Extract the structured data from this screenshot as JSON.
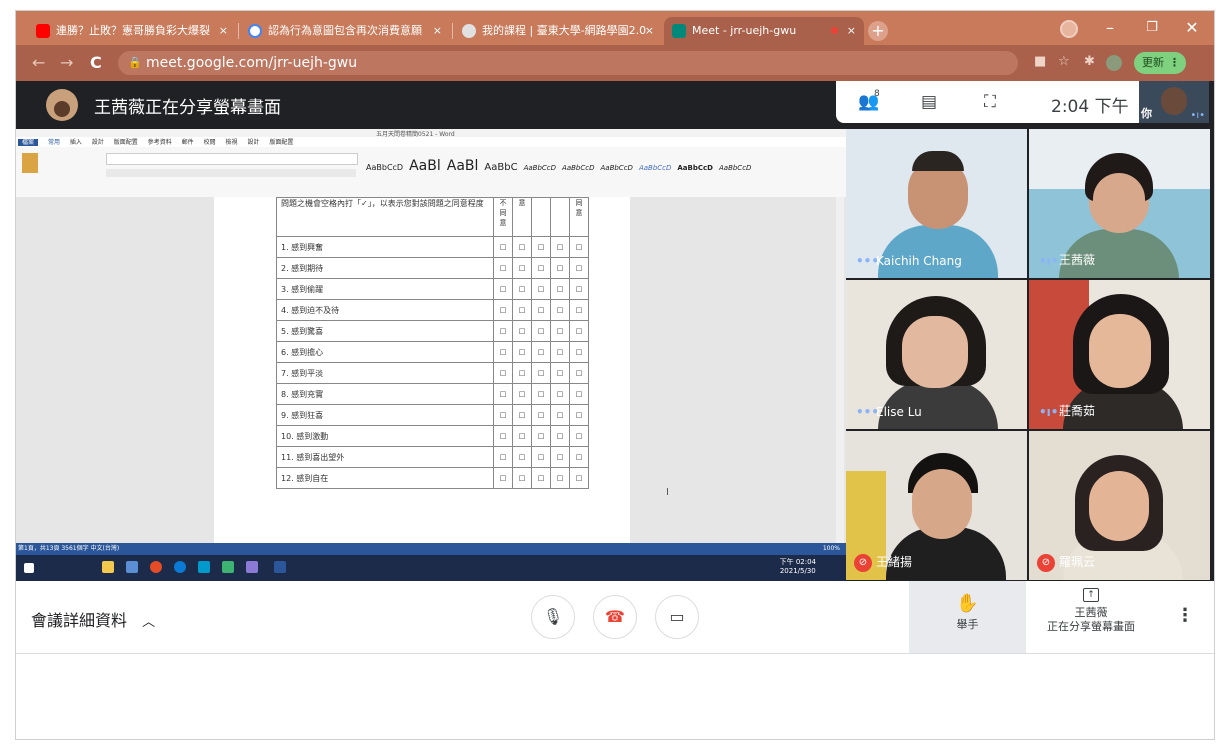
{
  "browser": {
    "tabs": [
      {
        "title": "連勝？止敗？憲哥勝負彩大爆裂",
        "icon_color": "#ff0000",
        "icon": "youtube-icon"
      },
      {
        "title": "認為行為意圖包含再次消費意願",
        "icon_color": "#4285f4",
        "icon": "google-icon"
      },
      {
        "title": "我的課程 | 臺東大學-網路學園2.0",
        "icon_color": "#555555",
        "icon": "globe-icon"
      },
      {
        "title": "Meet - jrr-uejh-gwu",
        "icon_color": "#00897b",
        "icon": "meet-icon"
      }
    ],
    "tab_close": "×",
    "new_tab": "+",
    "window": {
      "minimize": "–",
      "maximize": "❐",
      "close": "✕"
    },
    "url": "meet.google.com/jrr-uejh-gwu",
    "update_label": "更新",
    "nav": {
      "back": "←",
      "forward": "→",
      "reload": "C"
    }
  },
  "meet": {
    "presenter_banner": "王茜薇正在分享螢幕畫面",
    "participants_count": "8",
    "clock": "2:04 下午",
    "self_label": "你",
    "participants": [
      {
        "name": "Kaichih Chang",
        "status": "speaking-dots"
      },
      {
        "name": "王茜薇",
        "status": "audio"
      },
      {
        "name": "Elise Lu",
        "status": "speaking-dots"
      },
      {
        "name": "莊喬茹",
        "status": "audio"
      },
      {
        "name": "王緒揚",
        "status": "muted"
      },
      {
        "name": "羅珮云",
        "status": "muted"
      }
    ],
    "controls": {
      "meeting_details": "會議詳細資料",
      "raise_hand": "舉手",
      "presenter_name": "王茜薇",
      "presenting_label": "正在分享螢幕畫面"
    }
  },
  "shared_doc": {
    "title": "五月天問卷精簡0521 - Word",
    "ribbon_tabs": [
      "檔案",
      "常用",
      "插入",
      "設計",
      "版面配置",
      "參考資料",
      "郵件",
      "校閱",
      "檢視",
      "設計",
      "版面配置"
    ],
    "styles": [
      "AaBbCcD",
      "AaBl",
      "AaBl",
      "AaBbC",
      "AaBbCcD",
      "AaBbCcD",
      "AaBbCcD",
      "AaBbCcD",
      "AaBbCcD",
      "AaBbCcD"
    ],
    "header_text": "問題之機會空格內打「✓」，以表示您對該問題之同意程度",
    "col_header_1": "不同意",
    "col_header_2": "意",
    "col_header_3": "同意",
    "items": [
      "1. 感到興奮",
      "2. 感到期待",
      "3. 感到偷躍",
      "4. 感到迫不及待",
      "5. 感到驚喜",
      "6. 感到擔心",
      "7. 感到平淡",
      "8. 感到充實",
      "9. 感到狂喜",
      "10. 感到激動",
      "11. 感到喜出望外",
      "12. 感到自在"
    ],
    "checkbox": "□",
    "status_text": "第1頁，共13頁  3561個字  中文(台灣)",
    "zoom": "100%",
    "taskbar_time": "下午 02:04",
    "taskbar_date": "2021/5/30"
  }
}
